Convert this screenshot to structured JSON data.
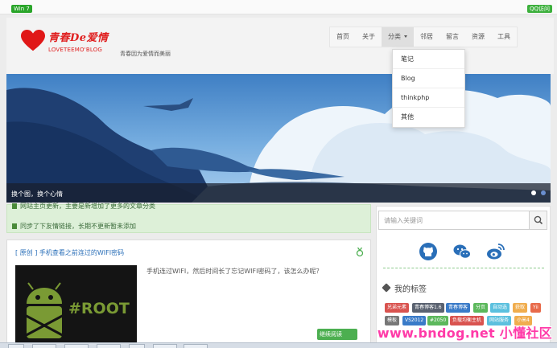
{
  "topbar": {
    "left_badge": "Win 7",
    "right_badge": "QQ访问"
  },
  "header": {
    "logo_script": "青春De爱情",
    "logo_sub": "LOVETEEMO'BLOG",
    "slogan": "青春因为爱情而美丽"
  },
  "nav": {
    "items": [
      "首页",
      "关于",
      "分类",
      "邻居",
      "留言",
      "资源",
      "工具"
    ],
    "active": "分类"
  },
  "dropdown": {
    "items": [
      "笔记",
      "Blog",
      "thinkphp",
      "其他"
    ]
  },
  "banner": {
    "caption": "换个图，换个心情"
  },
  "notice": {
    "line1": "网站主页更新，主要是新增加了更多的文章分类",
    "line2": "同步了下友情链接，长期不更新暂未添加"
  },
  "post": {
    "title": "[ 原创 ] 手机查看之前连过的WIFI密码",
    "thumb_text": "#ROOT",
    "excerpt": "手机连过WIFI，然后时间长了忘记WIFI密码了，该怎么办呢？",
    "more_label": "继续阅读"
  },
  "sidebar": {
    "search_placeholder": "请输入关键词",
    "tags_title": "我的标签",
    "tags": [
      {
        "label": "兄弟元素",
        "color": "#d9534f"
      },
      {
        "label": "青春博客1.6",
        "color": "#5a6270"
      },
      {
        "label": "青春博客",
        "color": "#3a7bc8"
      },
      {
        "label": "分页",
        "color": "#5cb85c"
      },
      {
        "label": "自动选",
        "color": "#5bc0de"
      },
      {
        "label": "获取",
        "color": "#f0ad4e"
      },
      {
        "label": "Yii",
        "color": "#e86a4a"
      },
      {
        "label": "模板",
        "color": "#777777"
      },
      {
        "label": "VS2012",
        "color": "#3a7bc8"
      },
      {
        "label": "#2050",
        "color": "#5cb85c"
      },
      {
        "label": "负载均衡主机",
        "color": "#d9534f"
      },
      {
        "label": "网站服务",
        "color": "#5bc0de"
      },
      {
        "label": "小米4",
        "color": "#f0ad4e"
      }
    ]
  },
  "watermark": "www.bndog.net 小懂社区",
  "colors": {
    "accent_red": "#e02020",
    "link_blue": "#2a6fb8",
    "green": "#4caf50"
  },
  "icons": [
    "heart-logo-icon",
    "caret-down-icon",
    "bookmark-icon",
    "search-icon",
    "github-icon",
    "wechat-icon",
    "weibo-icon",
    "tag-icon"
  ]
}
